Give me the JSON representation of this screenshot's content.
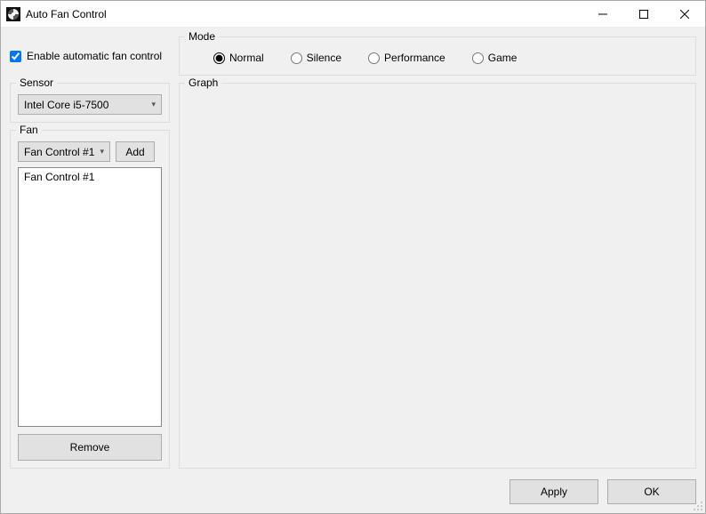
{
  "title": "Auto Fan Control",
  "enable": {
    "label": "Enable automatic fan control",
    "checked": true
  },
  "sensor": {
    "group_label": "Sensor",
    "selected": "Intel Core i5-7500"
  },
  "fan": {
    "group_label": "Fan",
    "selected": "Fan Control #1",
    "add_label": "Add",
    "list": [
      "Fan Control #1"
    ],
    "remove_label": "Remove"
  },
  "mode": {
    "group_label": "Mode",
    "selected": "Normal",
    "options": [
      "Normal",
      "Silence",
      "Performance",
      "Game"
    ]
  },
  "graph": {
    "group_label": "Graph"
  },
  "buttons": {
    "apply": "Apply",
    "ok": "OK"
  }
}
